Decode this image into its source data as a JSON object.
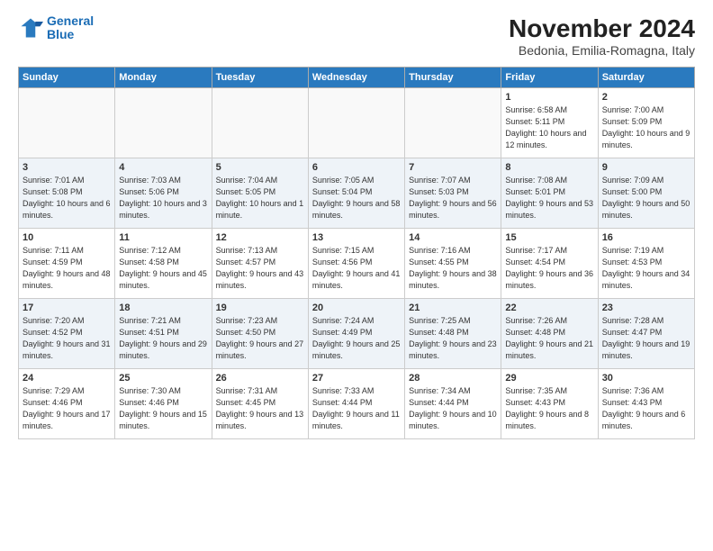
{
  "logo": {
    "line1": "General",
    "line2": "Blue"
  },
  "title": "November 2024",
  "location": "Bedonia, Emilia-Romagna, Italy",
  "weekdays": [
    "Sunday",
    "Monday",
    "Tuesday",
    "Wednesday",
    "Thursday",
    "Friday",
    "Saturday"
  ],
  "weeks": [
    [
      {
        "day": "",
        "info": ""
      },
      {
        "day": "",
        "info": ""
      },
      {
        "day": "",
        "info": ""
      },
      {
        "day": "",
        "info": ""
      },
      {
        "day": "",
        "info": ""
      },
      {
        "day": "1",
        "info": "Sunrise: 6:58 AM\nSunset: 5:11 PM\nDaylight: 10 hours and 12 minutes."
      },
      {
        "day": "2",
        "info": "Sunrise: 7:00 AM\nSunset: 5:09 PM\nDaylight: 10 hours and 9 minutes."
      }
    ],
    [
      {
        "day": "3",
        "info": "Sunrise: 7:01 AM\nSunset: 5:08 PM\nDaylight: 10 hours and 6 minutes."
      },
      {
        "day": "4",
        "info": "Sunrise: 7:03 AM\nSunset: 5:06 PM\nDaylight: 10 hours and 3 minutes."
      },
      {
        "day": "5",
        "info": "Sunrise: 7:04 AM\nSunset: 5:05 PM\nDaylight: 10 hours and 1 minute."
      },
      {
        "day": "6",
        "info": "Sunrise: 7:05 AM\nSunset: 5:04 PM\nDaylight: 9 hours and 58 minutes."
      },
      {
        "day": "7",
        "info": "Sunrise: 7:07 AM\nSunset: 5:03 PM\nDaylight: 9 hours and 56 minutes."
      },
      {
        "day": "8",
        "info": "Sunrise: 7:08 AM\nSunset: 5:01 PM\nDaylight: 9 hours and 53 minutes."
      },
      {
        "day": "9",
        "info": "Sunrise: 7:09 AM\nSunset: 5:00 PM\nDaylight: 9 hours and 50 minutes."
      }
    ],
    [
      {
        "day": "10",
        "info": "Sunrise: 7:11 AM\nSunset: 4:59 PM\nDaylight: 9 hours and 48 minutes."
      },
      {
        "day": "11",
        "info": "Sunrise: 7:12 AM\nSunset: 4:58 PM\nDaylight: 9 hours and 45 minutes."
      },
      {
        "day": "12",
        "info": "Sunrise: 7:13 AM\nSunset: 4:57 PM\nDaylight: 9 hours and 43 minutes."
      },
      {
        "day": "13",
        "info": "Sunrise: 7:15 AM\nSunset: 4:56 PM\nDaylight: 9 hours and 41 minutes."
      },
      {
        "day": "14",
        "info": "Sunrise: 7:16 AM\nSunset: 4:55 PM\nDaylight: 9 hours and 38 minutes."
      },
      {
        "day": "15",
        "info": "Sunrise: 7:17 AM\nSunset: 4:54 PM\nDaylight: 9 hours and 36 minutes."
      },
      {
        "day": "16",
        "info": "Sunrise: 7:19 AM\nSunset: 4:53 PM\nDaylight: 9 hours and 34 minutes."
      }
    ],
    [
      {
        "day": "17",
        "info": "Sunrise: 7:20 AM\nSunset: 4:52 PM\nDaylight: 9 hours and 31 minutes."
      },
      {
        "day": "18",
        "info": "Sunrise: 7:21 AM\nSunset: 4:51 PM\nDaylight: 9 hours and 29 minutes."
      },
      {
        "day": "19",
        "info": "Sunrise: 7:23 AM\nSunset: 4:50 PM\nDaylight: 9 hours and 27 minutes."
      },
      {
        "day": "20",
        "info": "Sunrise: 7:24 AM\nSunset: 4:49 PM\nDaylight: 9 hours and 25 minutes."
      },
      {
        "day": "21",
        "info": "Sunrise: 7:25 AM\nSunset: 4:48 PM\nDaylight: 9 hours and 23 minutes."
      },
      {
        "day": "22",
        "info": "Sunrise: 7:26 AM\nSunset: 4:48 PM\nDaylight: 9 hours and 21 minutes."
      },
      {
        "day": "23",
        "info": "Sunrise: 7:28 AM\nSunset: 4:47 PM\nDaylight: 9 hours and 19 minutes."
      }
    ],
    [
      {
        "day": "24",
        "info": "Sunrise: 7:29 AM\nSunset: 4:46 PM\nDaylight: 9 hours and 17 minutes."
      },
      {
        "day": "25",
        "info": "Sunrise: 7:30 AM\nSunset: 4:46 PM\nDaylight: 9 hours and 15 minutes."
      },
      {
        "day": "26",
        "info": "Sunrise: 7:31 AM\nSunset: 4:45 PM\nDaylight: 9 hours and 13 minutes."
      },
      {
        "day": "27",
        "info": "Sunrise: 7:33 AM\nSunset: 4:44 PM\nDaylight: 9 hours and 11 minutes."
      },
      {
        "day": "28",
        "info": "Sunrise: 7:34 AM\nSunset: 4:44 PM\nDaylight: 9 hours and 10 minutes."
      },
      {
        "day": "29",
        "info": "Sunrise: 7:35 AM\nSunset: 4:43 PM\nDaylight: 9 hours and 8 minutes."
      },
      {
        "day": "30",
        "info": "Sunrise: 7:36 AM\nSunset: 4:43 PM\nDaylight: 9 hours and 6 minutes."
      }
    ]
  ]
}
